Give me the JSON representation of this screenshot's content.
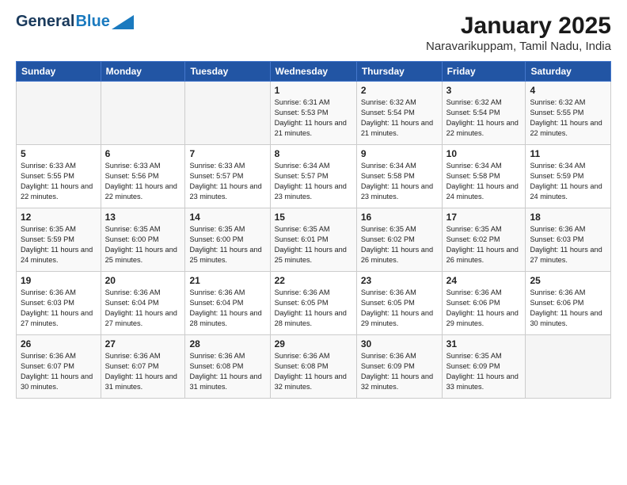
{
  "logo": {
    "part1": "General",
    "part2": "Blue"
  },
  "title": "January 2025",
  "subtitle": "Naravarikuppam, Tamil Nadu, India",
  "header_days": [
    "Sunday",
    "Monday",
    "Tuesday",
    "Wednesday",
    "Thursday",
    "Friday",
    "Saturday"
  ],
  "weeks": [
    [
      {
        "day": "",
        "info": ""
      },
      {
        "day": "",
        "info": ""
      },
      {
        "day": "",
        "info": ""
      },
      {
        "day": "1",
        "info": "Sunrise: 6:31 AM\nSunset: 5:53 PM\nDaylight: 11 hours and 21 minutes."
      },
      {
        "day": "2",
        "info": "Sunrise: 6:32 AM\nSunset: 5:54 PM\nDaylight: 11 hours and 21 minutes."
      },
      {
        "day": "3",
        "info": "Sunrise: 6:32 AM\nSunset: 5:54 PM\nDaylight: 11 hours and 22 minutes."
      },
      {
        "day": "4",
        "info": "Sunrise: 6:32 AM\nSunset: 5:55 PM\nDaylight: 11 hours and 22 minutes."
      }
    ],
    [
      {
        "day": "5",
        "info": "Sunrise: 6:33 AM\nSunset: 5:55 PM\nDaylight: 11 hours and 22 minutes."
      },
      {
        "day": "6",
        "info": "Sunrise: 6:33 AM\nSunset: 5:56 PM\nDaylight: 11 hours and 22 minutes."
      },
      {
        "day": "7",
        "info": "Sunrise: 6:33 AM\nSunset: 5:57 PM\nDaylight: 11 hours and 23 minutes."
      },
      {
        "day": "8",
        "info": "Sunrise: 6:34 AM\nSunset: 5:57 PM\nDaylight: 11 hours and 23 minutes."
      },
      {
        "day": "9",
        "info": "Sunrise: 6:34 AM\nSunset: 5:58 PM\nDaylight: 11 hours and 23 minutes."
      },
      {
        "day": "10",
        "info": "Sunrise: 6:34 AM\nSunset: 5:58 PM\nDaylight: 11 hours and 24 minutes."
      },
      {
        "day": "11",
        "info": "Sunrise: 6:34 AM\nSunset: 5:59 PM\nDaylight: 11 hours and 24 minutes."
      }
    ],
    [
      {
        "day": "12",
        "info": "Sunrise: 6:35 AM\nSunset: 5:59 PM\nDaylight: 11 hours and 24 minutes."
      },
      {
        "day": "13",
        "info": "Sunrise: 6:35 AM\nSunset: 6:00 PM\nDaylight: 11 hours and 25 minutes."
      },
      {
        "day": "14",
        "info": "Sunrise: 6:35 AM\nSunset: 6:00 PM\nDaylight: 11 hours and 25 minutes."
      },
      {
        "day": "15",
        "info": "Sunrise: 6:35 AM\nSunset: 6:01 PM\nDaylight: 11 hours and 25 minutes."
      },
      {
        "day": "16",
        "info": "Sunrise: 6:35 AM\nSunset: 6:02 PM\nDaylight: 11 hours and 26 minutes."
      },
      {
        "day": "17",
        "info": "Sunrise: 6:35 AM\nSunset: 6:02 PM\nDaylight: 11 hours and 26 minutes."
      },
      {
        "day": "18",
        "info": "Sunrise: 6:36 AM\nSunset: 6:03 PM\nDaylight: 11 hours and 27 minutes."
      }
    ],
    [
      {
        "day": "19",
        "info": "Sunrise: 6:36 AM\nSunset: 6:03 PM\nDaylight: 11 hours and 27 minutes."
      },
      {
        "day": "20",
        "info": "Sunrise: 6:36 AM\nSunset: 6:04 PM\nDaylight: 11 hours and 27 minutes."
      },
      {
        "day": "21",
        "info": "Sunrise: 6:36 AM\nSunset: 6:04 PM\nDaylight: 11 hours and 28 minutes."
      },
      {
        "day": "22",
        "info": "Sunrise: 6:36 AM\nSunset: 6:05 PM\nDaylight: 11 hours and 28 minutes."
      },
      {
        "day": "23",
        "info": "Sunrise: 6:36 AM\nSunset: 6:05 PM\nDaylight: 11 hours and 29 minutes."
      },
      {
        "day": "24",
        "info": "Sunrise: 6:36 AM\nSunset: 6:06 PM\nDaylight: 11 hours and 29 minutes."
      },
      {
        "day": "25",
        "info": "Sunrise: 6:36 AM\nSunset: 6:06 PM\nDaylight: 11 hours and 30 minutes."
      }
    ],
    [
      {
        "day": "26",
        "info": "Sunrise: 6:36 AM\nSunset: 6:07 PM\nDaylight: 11 hours and 30 minutes."
      },
      {
        "day": "27",
        "info": "Sunrise: 6:36 AM\nSunset: 6:07 PM\nDaylight: 11 hours and 31 minutes."
      },
      {
        "day": "28",
        "info": "Sunrise: 6:36 AM\nSunset: 6:08 PM\nDaylight: 11 hours and 31 minutes."
      },
      {
        "day": "29",
        "info": "Sunrise: 6:36 AM\nSunset: 6:08 PM\nDaylight: 11 hours and 32 minutes."
      },
      {
        "day": "30",
        "info": "Sunrise: 6:36 AM\nSunset: 6:09 PM\nDaylight: 11 hours and 32 minutes."
      },
      {
        "day": "31",
        "info": "Sunrise: 6:35 AM\nSunset: 6:09 PM\nDaylight: 11 hours and 33 minutes."
      },
      {
        "day": "",
        "info": ""
      }
    ]
  ]
}
